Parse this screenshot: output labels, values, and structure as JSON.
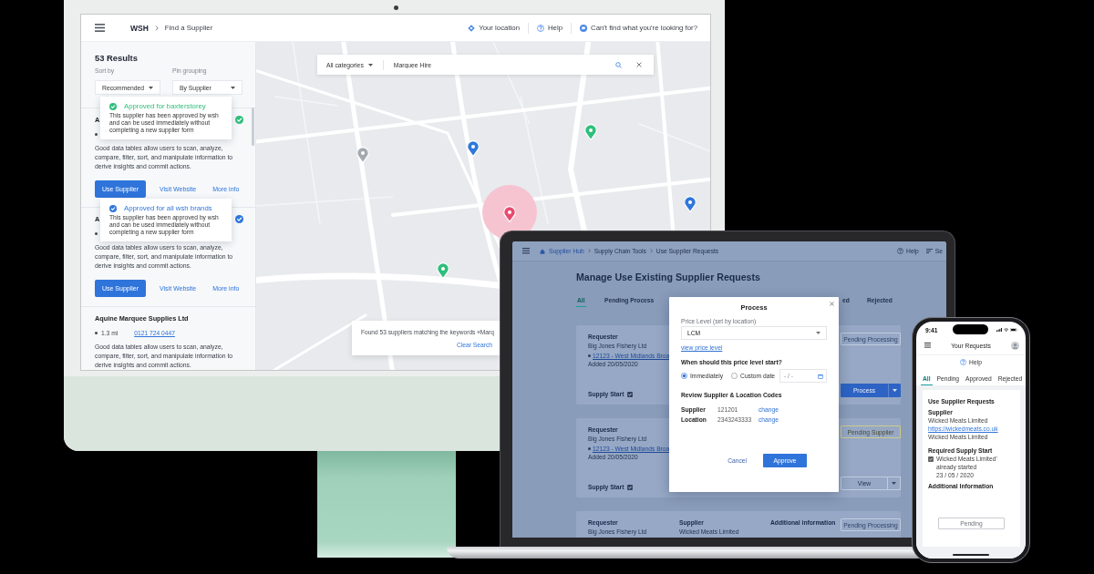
{
  "desktop": {
    "header": {
      "brand": "WSH",
      "page": "Find a Supplier",
      "actions": [
        {
          "kind": "location",
          "label": "Your location"
        },
        {
          "kind": "help",
          "label": "Help"
        },
        {
          "kind": "chat",
          "label": "Can't find what you're looking for?"
        }
      ]
    },
    "sidebar": {
      "results": "53 Results",
      "filters": [
        {
          "label": "Sort by",
          "value": "Recommended"
        },
        {
          "label": "Pin grouping",
          "value": "By Supplier"
        }
      ],
      "suppliers": [
        {
          "name": "A",
          "color": "#2fbf7b",
          "description": "Good data tables allow users to scan, analyze, compare, filter, sort, and manipulate information to derive insights and commit actions.",
          "buttons": [
            {
              "kind": "primary",
              "label": "Use Supplier"
            },
            {
              "kind": "link",
              "label": "Visit Website"
            },
            {
              "kind": "link",
              "label": "More info"
            }
          ]
        },
        {
          "name": "A",
          "color": "#2f77dd",
          "description": "Good data tables allow users to scan, analyze, compare, filter, sort, and manipulate information to derive insights and commit actions.",
          "buttons": [
            {
              "kind": "primary",
              "label": "Use Supplier"
            },
            {
              "kind": "link",
              "label": "Visit Website"
            },
            {
              "kind": "link",
              "label": "More info"
            }
          ]
        },
        {
          "name": "Aquine Marquee Supplies Ltd",
          "distance": "1.3 mi",
          "phone": "0121 724 0447",
          "description": "Good data tables allow users to scan, analyze, compare, filter, sort, and manipulate information to derive insights and commit actions."
        }
      ],
      "tooltips": [
        {
          "color": "#2fbf7b",
          "title": "Approved for baxterstorey",
          "text": "This supplier has been approved by wsh and can be used immediately without completing a new supplier form"
        },
        {
          "color": "#2f77dd",
          "title": "Approved for all wsh brands",
          "text": "This supplier has been approved by wsh and can be used immediately without completing a new supplier form"
        }
      ]
    },
    "map": {
      "category": "All categories",
      "query": "Marquee Hire",
      "pins": [
        {
          "color": "#a4a9b0",
          "selected": false
        },
        {
          "color": "#2f77dd",
          "selected": false
        },
        {
          "color": "#2fbf7b",
          "selected": false
        },
        {
          "color": "#e84a6f",
          "selected": true
        },
        {
          "color": "#2fbf7b",
          "selected": false
        },
        {
          "color": "#2f77dd",
          "selected": false
        }
      ],
      "toast": {
        "message": "Found 53 suppliers matching the keywords «Marq",
        "action": "Clear Search"
      }
    }
  },
  "laptop": {
    "breadcrumb": [
      "Supplier Hub",
      "Supply Chain Tools",
      "Use Supplier Requests"
    ],
    "actions": [
      {
        "kind": "help",
        "label": "Help"
      },
      {
        "kind": "list",
        "label": "Se"
      }
    ],
    "title": "Manage Use Existing Supplier Requests",
    "tabs": [
      {
        "label": "All",
        "selected": true
      },
      {
        "label": "Pending Process",
        "selected": false
      },
      {
        "label": "ed",
        "selected": false
      },
      {
        "label": "Rejected",
        "selected": false
      }
    ],
    "requests": [
      {
        "fields": [
          {
            "label": "Requester",
            "value": "Big Jones Fishery Ltd",
            "link": "12123 - West Midlands Broa",
            "note": "Added 20/05/2020"
          }
        ],
        "supply_start": {
          "label": "Supply Start",
          "checked": true
        },
        "status": {
          "kind": "processing",
          "label": "Pending Processing"
        },
        "action": {
          "kind": "primary",
          "label": "Process"
        }
      },
      {
        "fields": [
          {
            "label": "Requester",
            "value": "Big Jones Fishery Ltd",
            "link": "12123 - West Midlands Broa",
            "note": "Added 20/05/2020"
          }
        ],
        "supply_start": {
          "label": "Supply Start",
          "checked": true
        },
        "status": {
          "kind": "supplier",
          "label": "Pending Supplier"
        },
        "action": {
          "kind": "secondary",
          "label": "View"
        }
      },
      {
        "fields": [
          {
            "label": "Requester",
            "value": "Big Jones Fishery Ltd"
          },
          {
            "label": "Supplier",
            "value": "Wicked Meats Limited"
          },
          {
            "label": "Additional information"
          }
        ],
        "status": {
          "kind": "processing",
          "label": "Pending Processing"
        }
      }
    ],
    "modal": {
      "title": "Process",
      "price_label": "Price Level (set by location)",
      "price_value": "LCM",
      "price_link": "view price level",
      "question": "When should this price level start?",
      "options": [
        {
          "label": "Immediately",
          "selected": true
        },
        {
          "label": "Custom date",
          "selected": false
        }
      ],
      "date": {
        "placeholder": "- / -"
      },
      "review_title": "Review Supplier & Location Codes",
      "codes": [
        {
          "label": "Supplier",
          "value": "121201",
          "action": "change"
        },
        {
          "label": "Location",
          "value": "2343243333",
          "action": "change"
        }
      ],
      "buttons": [
        {
          "kind": "text",
          "label": "Cancel"
        },
        {
          "kind": "primary",
          "label": "Approve"
        }
      ]
    }
  },
  "phone": {
    "time": "9:41",
    "title": "Your Requests",
    "help": "Help",
    "tabs": [
      {
        "label": "All",
        "selected": true
      },
      {
        "label": "Pending",
        "selected": false
      },
      {
        "label": "Approved",
        "selected": false
      },
      {
        "label": "Rejected",
        "selected": false
      }
    ],
    "card": {
      "title": "Use Supplier Requests",
      "supplier_label": "Supplier",
      "supplier_lines": [
        {
          "kind": "text",
          "text": "Wicked Meats Limited"
        },
        {
          "kind": "link",
          "text": "https://wickedmeats.co.uk"
        },
        {
          "kind": "text",
          "text": "Wicked Meats Limited"
        }
      ],
      "start_label": "Required Supply Start",
      "start_option": {
        "label": "Wicked Meats Limited' already started",
        "checked": true
      },
      "start_date": "23 / 05 / 2020",
      "info_label": "Additional Information",
      "button": "Pending"
    }
  }
}
